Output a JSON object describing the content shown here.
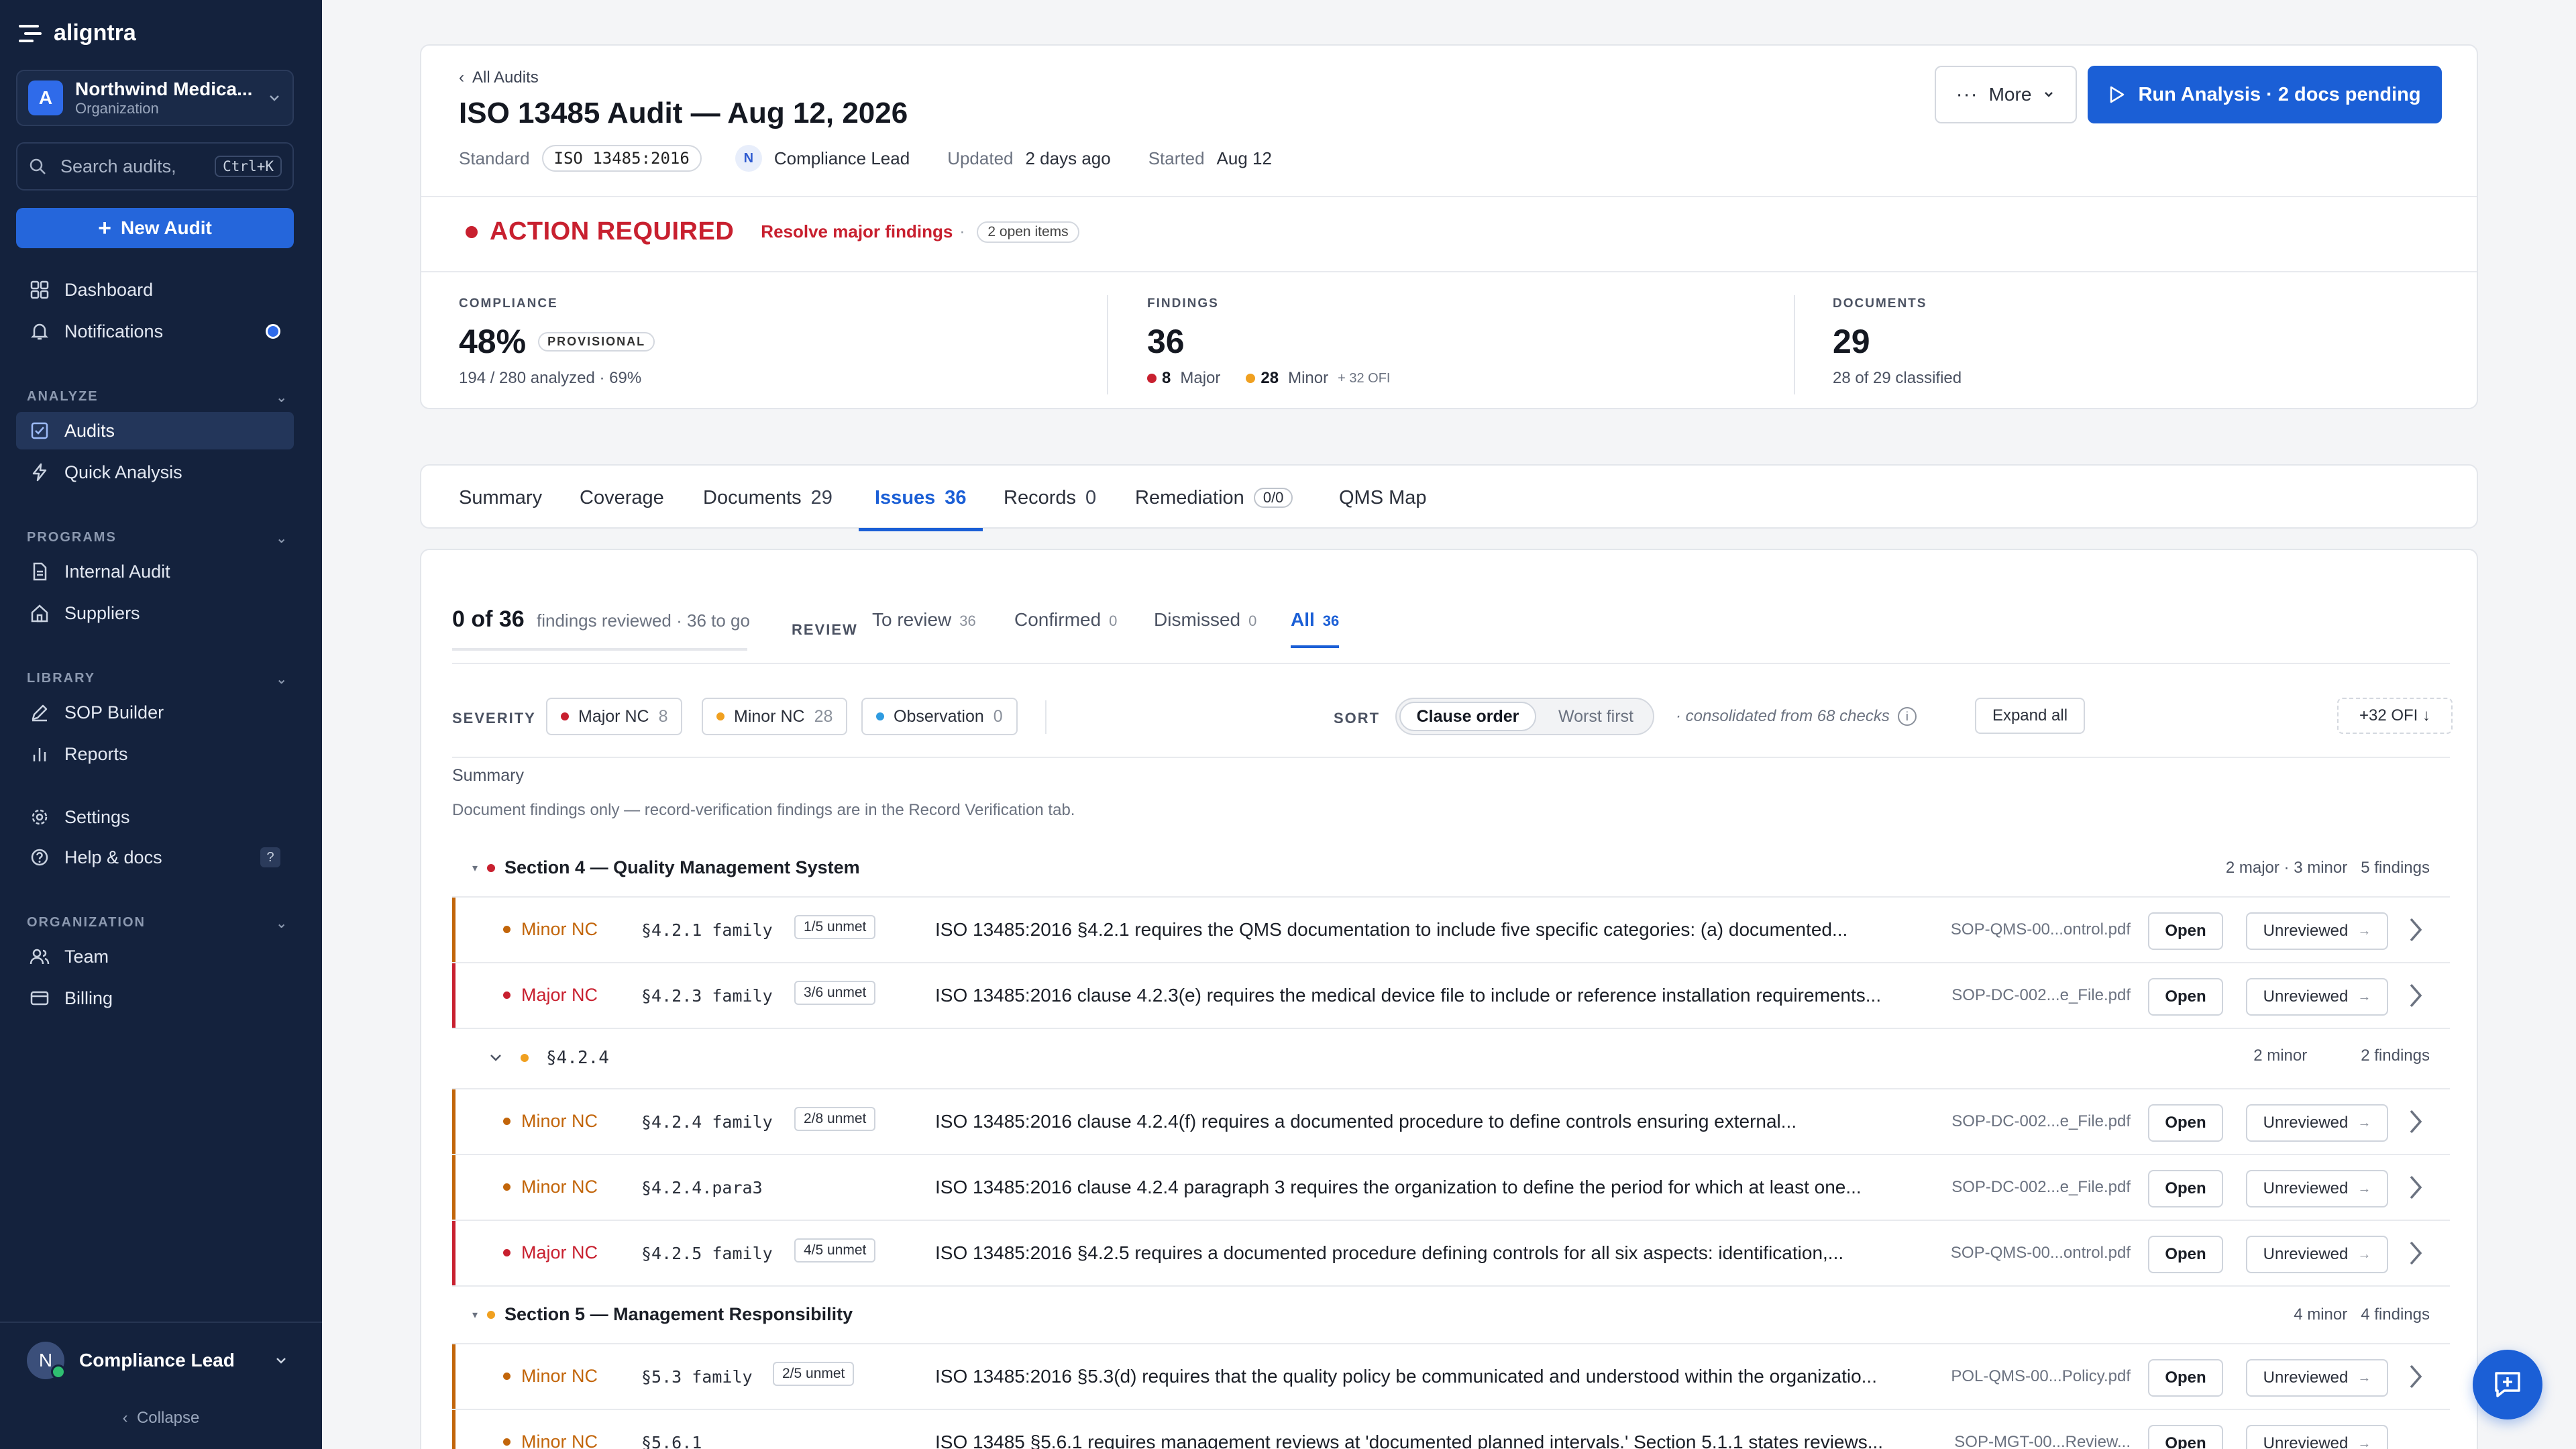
{
  "app": {
    "logo_text": "aligntra"
  },
  "sidebar": {
    "org_initial": "A",
    "org_name": "Northwind Medica...",
    "org_sub": "Organization",
    "search_placeholder": "Search audits,",
    "search_kbd": "Ctrl+K",
    "new_audit": "New Audit",
    "dashboard": "Dashboard",
    "notifications": "Notifications",
    "section_analyze": "ANALYZE",
    "audits": "Audits",
    "quick_analysis": "Quick Analysis",
    "section_programs": "PROGRAMS",
    "internal_audit": "Internal Audit",
    "suppliers": "Suppliers",
    "section_library": "LIBRARY",
    "sop_builder": "SOP Builder",
    "reports": "Reports",
    "settings": "Settings",
    "help": "Help & docs",
    "help_badge": "?",
    "section_org": "ORGANIZATION",
    "team": "Team",
    "billing": "Billing",
    "user_initial": "N",
    "user_name": "Compliance Lead",
    "collapse": "Collapse"
  },
  "header": {
    "back": "All Audits",
    "title": "ISO 13485 Audit — Aug 12, 2026",
    "standard_label": "Standard",
    "standard_value": "ISO 13485:2016",
    "owner_initial": "N",
    "owner": "Compliance Lead",
    "updated_label": "Updated",
    "updated_value": "2 days ago",
    "started_label": "Started",
    "started_value": "Aug 12",
    "more": "More",
    "run": "Run Analysis · 2 docs pending",
    "action_title": "ACTION REQUIRED",
    "action_sub": "Resolve major findings",
    "action_sep": "·",
    "open_items": "2 open items",
    "compliance_label": "COMPLIANCE",
    "compliance_value": "48%",
    "provisional": "PROVISIONAL",
    "compliance_sub": "194 / 280 analyzed · 69%",
    "findings_label": "FINDINGS",
    "findings_value": "36",
    "major_count": "8",
    "major_label": "Major",
    "minor_count": "28",
    "minor_label": "Minor",
    "ofi": "+ 32 OFI",
    "documents_label": "DOCUMENTS",
    "documents_value": "29",
    "documents_sub": "28 of 29 classified"
  },
  "tabs": {
    "summary": "Summary",
    "coverage": "Coverage",
    "documents": "Documents",
    "documents_count": "29",
    "issues": "Issues",
    "issues_count": "36",
    "records": "Records",
    "records_count": "0",
    "remediation": "Remediation",
    "remediation_count": "0/0",
    "qms_map": "QMS Map"
  },
  "review": {
    "count": "0 of 36",
    "sub": "findings reviewed · 36 to go",
    "label": "REVIEW",
    "to_review": "To review",
    "to_review_count": "36",
    "confirmed": "Confirmed",
    "confirmed_count": "0",
    "dismissed": "Dismissed",
    "dismissed_count": "0",
    "all": "All",
    "all_count": "36"
  },
  "filters": {
    "severity_label": "SEVERITY",
    "major": "Major NC",
    "major_count": "8",
    "minor": "Minor NC",
    "minor_count": "28",
    "observation": "Observation",
    "observation_count": "0",
    "sort_label": "SORT",
    "sort_clause": "Clause order",
    "sort_worst": "Worst first",
    "consolidated": "· consolidated from 68 checks",
    "info": "i",
    "expand": "Expand all",
    "ofi": "+32 OFI ↓"
  },
  "summary": {
    "label": "Summary",
    "text": "Document findings only — record-verification findings are in the Record Verification tab."
  },
  "sections": {
    "s4_title": "Section 4 — Quality Management System",
    "s4_stats": "2 major · 3 minor",
    "s4_findings": "5 findings",
    "sub424_title": "§4.2.4",
    "sub424_stats": "2 minor",
    "sub424_findings": "2 findings",
    "s5_title": "Section 5 — Management Responsibility",
    "s5_stats": "4 minor",
    "s5_findings": "4 findings"
  },
  "rows": [
    {
      "severity": "Minor NC",
      "clause": "§4.2.1 family",
      "unmet": "1/5 unmet",
      "desc": "ISO 13485:2016 §4.2.1 requires the QMS documentation to include five specific categories: (a) documented...",
      "file": "SOP-QMS-00...ontrol.pdf",
      "open": "Open",
      "status": "Unreviewed"
    },
    {
      "severity": "Major NC",
      "clause": "§4.2.3 family",
      "unmet": "3/6 unmet",
      "desc": "ISO 13485:2016 clause 4.2.3(e) requires the medical device file to include or reference installation requirements...",
      "file": "SOP-DC-002...e_File.pdf",
      "open": "Open",
      "status": "Unreviewed"
    },
    {
      "severity": "Minor NC",
      "clause": "§4.2.4 family",
      "unmet": "2/8 unmet",
      "desc": "ISO 13485:2016 clause 4.2.4(f) requires a documented procedure to define controls ensuring external...",
      "file": "SOP-DC-002...e_File.pdf",
      "open": "Open",
      "status": "Unreviewed"
    },
    {
      "severity": "Minor NC",
      "clause": "§4.2.4.para3",
      "unmet": "",
      "desc": "ISO 13485:2016 clause 4.2.4 paragraph 3 requires the organization to define the period for which at least one...",
      "file": "SOP-DC-002...e_File.pdf",
      "open": "Open",
      "status": "Unreviewed"
    },
    {
      "severity": "Major NC",
      "clause": "§4.2.5 family",
      "unmet": "4/5 unmet",
      "desc": "ISO 13485:2016 §4.2.5 requires a documented procedure defining controls for all six aspects: identification,...",
      "file": "SOP-QMS-00...ontrol.pdf",
      "open": "Open",
      "status": "Unreviewed"
    },
    {
      "severity": "Minor NC",
      "clause": "§5.3 family",
      "unmet": "2/5 unmet",
      "desc": "ISO 13485:2016 §5.3(d) requires that the quality policy be communicated and understood within the organizatio...",
      "file": "POL-QMS-00...Policy.pdf",
      "open": "Open",
      "status": "Unreviewed"
    },
    {
      "severity": "Minor NC",
      "clause": "§5.6.1",
      "unmet": "",
      "desc": "ISO 13485 §5.6.1 requires management reviews at 'documented planned intervals.' Section 5.1.1 states reviews...",
      "file": "SOP-MGT-00...Review...",
      "open": "Open",
      "status": "Unreviewed"
    }
  ],
  "colors": {
    "major": "#c8202f",
    "minor": "#c2650a",
    "minor_dot": "#f0a020",
    "observation": "#2f9be0",
    "accent": "#1b5fd6"
  }
}
